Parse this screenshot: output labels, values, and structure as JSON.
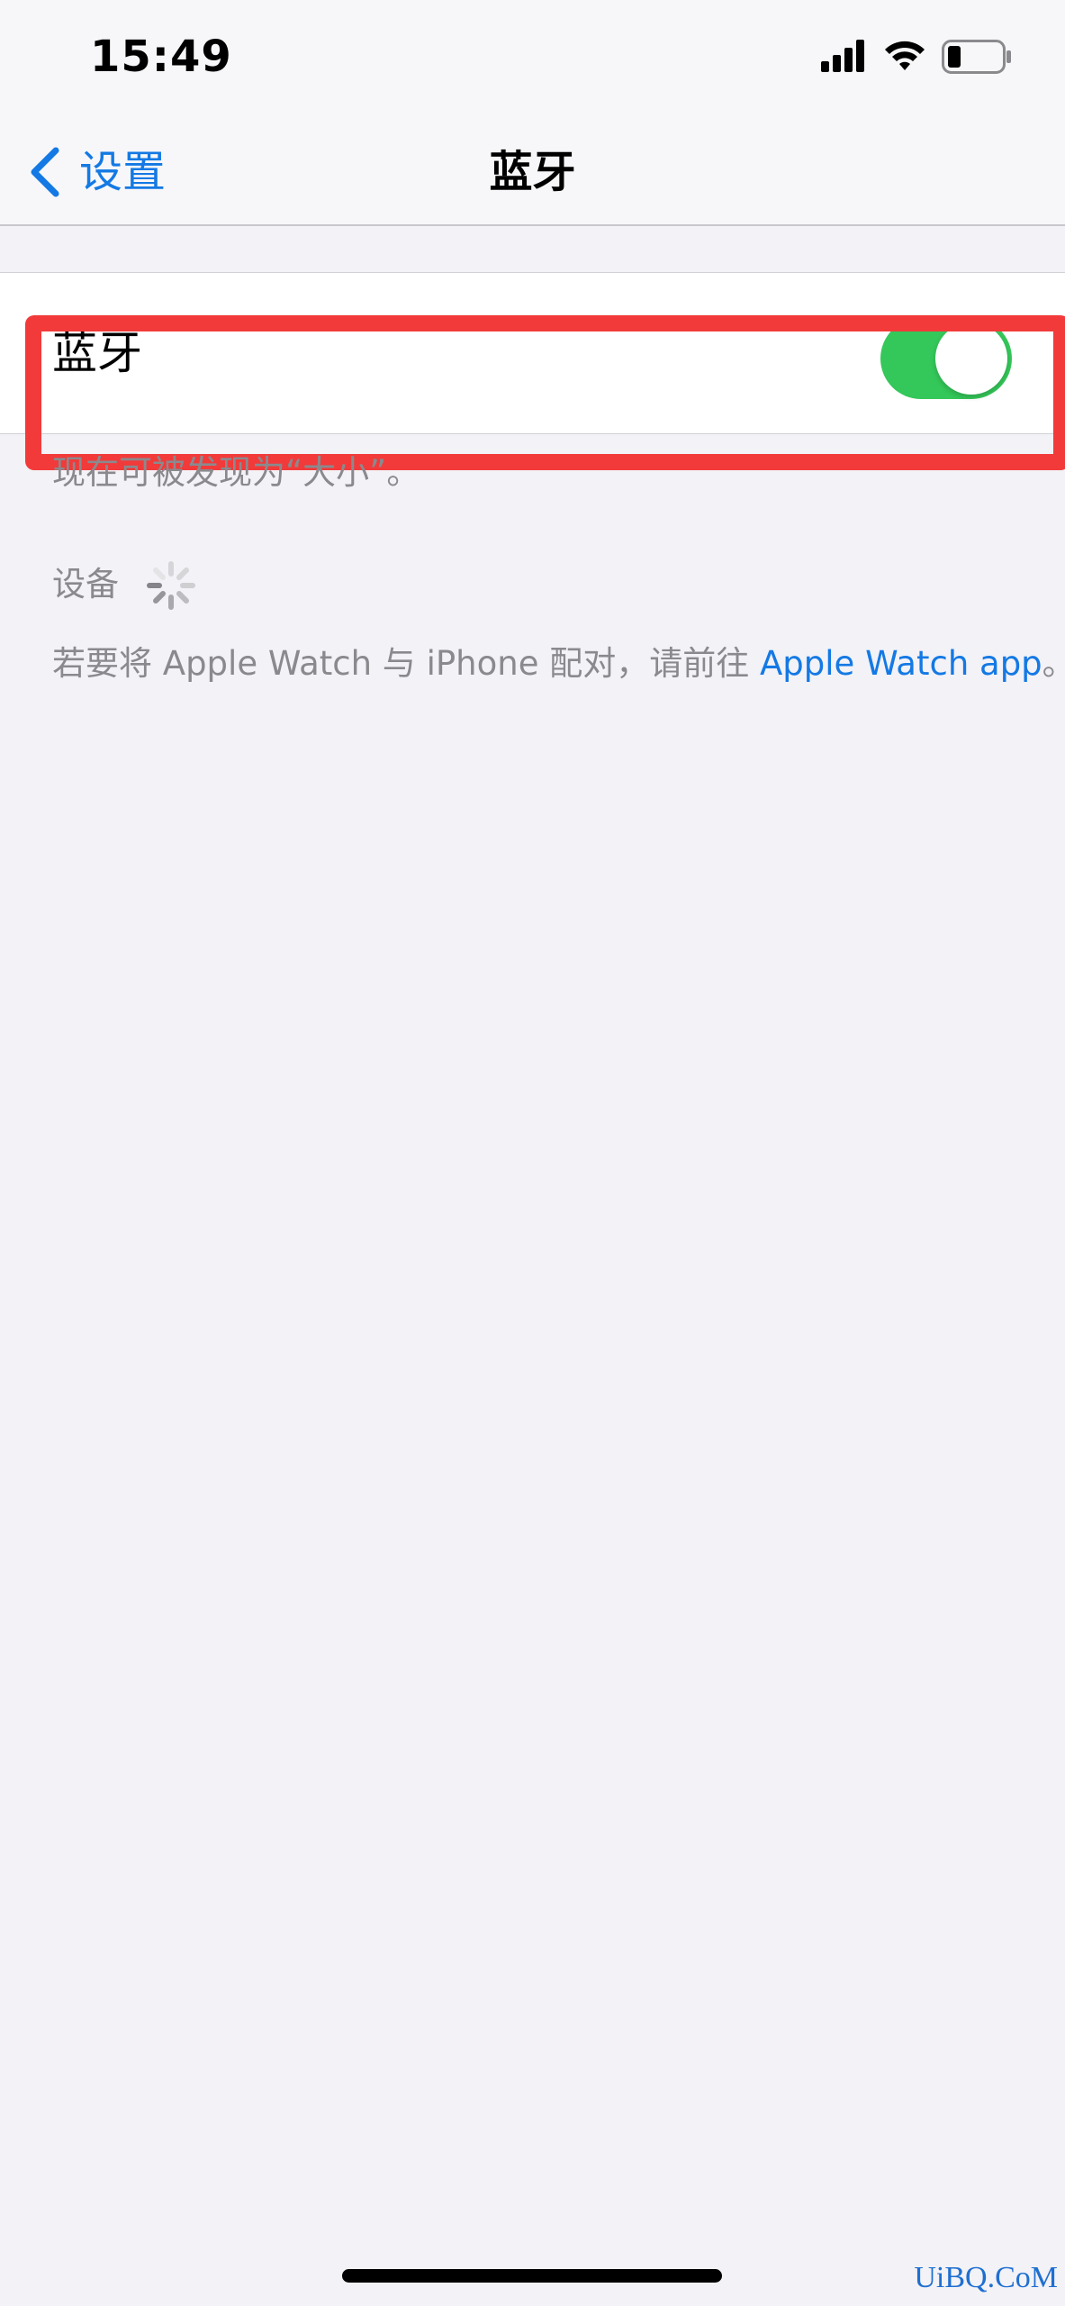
{
  "status_bar": {
    "time": "15:49",
    "icons": [
      "signal-icon",
      "wifi-icon",
      "battery-icon"
    ]
  },
  "nav": {
    "back_label": "设置",
    "title": "蓝牙"
  },
  "bluetooth": {
    "label": "蓝牙",
    "enabled": true,
    "discoverable_text": "现在可被发现为“大小”。"
  },
  "devices": {
    "header": "设备",
    "pair_hint_prefix": "若要将 Apple Watch 与 iPhone 配对，请前往 ",
    "pair_link": "Apple Watch app",
    "pair_hint_suffix": "。"
  },
  "watermark": "UiBQ.CoM",
  "colors": {
    "accent": "#1479e4",
    "toggle_on": "#34c759",
    "highlight": "#f23a3a",
    "background": "#f2f2f7"
  }
}
